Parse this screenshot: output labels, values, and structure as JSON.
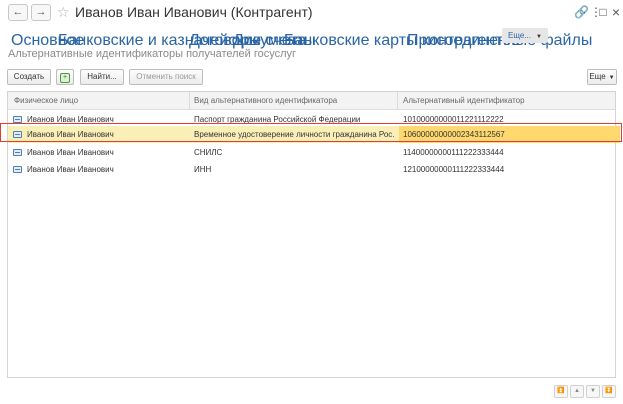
{
  "window": {
    "title": "Иванов Иван Иванович (Контрагент)",
    "back_icon": "←",
    "forward_icon": "→",
    "star_icon": "☆",
    "link_icon": "🔗",
    "menu_icon": "⋮",
    "maximize_icon": "□",
    "close_icon": "×"
  },
  "nav": {
    "links": [
      "Основное",
      "Банковские и казначейские счета",
      "Договоры",
      "Документы",
      "Банковские карты контрагентов",
      "Присоединенные файлы"
    ],
    "more_label": "Еще...",
    "more_caret": "▼"
  },
  "section": {
    "title": "Альтернативные идентификаторы получателей госуслуг"
  },
  "toolbar": {
    "create_label": "Создать",
    "copy_icon_glyph": "+",
    "find_label": "Найти...",
    "cancel_search_label": "Отменить поиск",
    "more_label": "Еще",
    "more_caret": "▼"
  },
  "table": {
    "columns": [
      "Физическое лицо",
      "Вид альтернативного идентификатора",
      "Альтернативный идентификатор"
    ],
    "rows": [
      {
        "person": "Иванов Иван Иванович",
        "type": "Паспорт гражданина Российской Федерации",
        "id": "10100000000011221112222",
        "selected": false
      },
      {
        "person": "Иванов Иван Иванович",
        "type": "Временное удостоверение личности гражданина Рос...",
        "id": "10600000000002343112567",
        "selected": true
      },
      {
        "person": "Иванов Иван Иванович",
        "type": "СНИЛС",
        "id": "11400000000111222333444",
        "selected": false
      },
      {
        "person": "Иванов Иван Иванович",
        "type": "ИНН",
        "id": "12100000000111222333444",
        "selected": false
      }
    ]
  },
  "footer": {
    "scroll_buttons": [
      "⏫",
      "▲",
      "▼",
      "⏬"
    ]
  },
  "colors": {
    "link": "#2a65a5",
    "selected_row": "#fbefb8",
    "active_cell": "#ffd970",
    "highlight_frame": "#e53c2f"
  }
}
